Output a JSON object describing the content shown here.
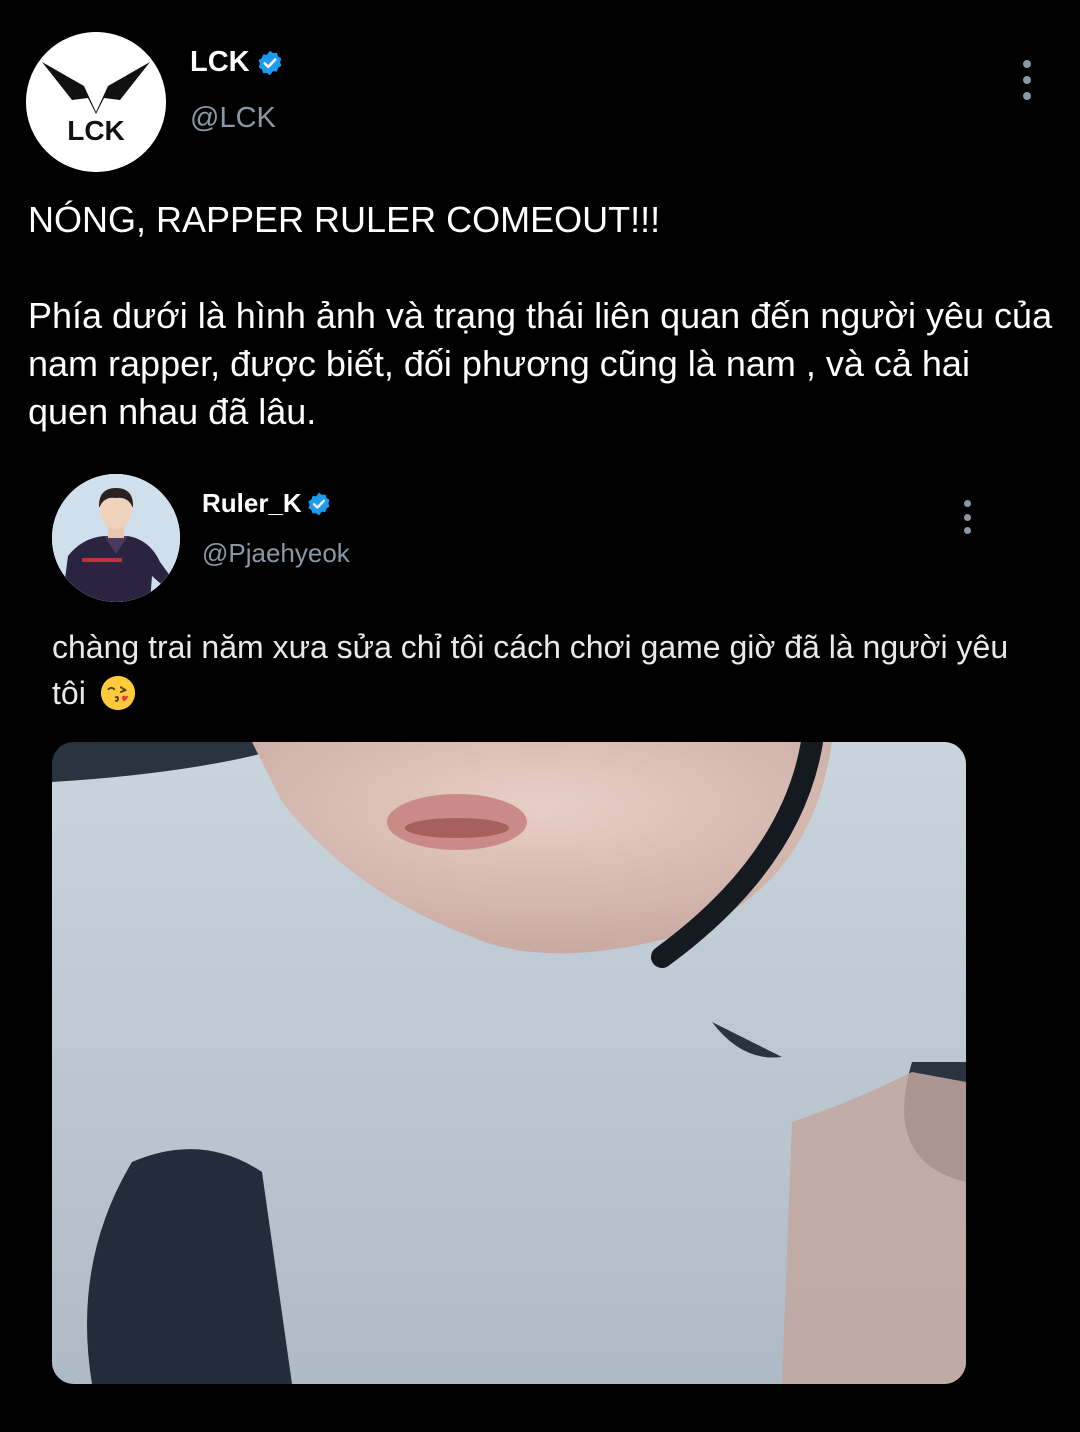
{
  "tweet": {
    "author": {
      "name": "LCK",
      "handle": "@LCK",
      "logo_text": "LCK",
      "verified": true
    },
    "headline": "NÓNG, RAPPER RULER COMEOUT!!!",
    "body": "Phía dưới là hình ảnh và trạng thái liên quan đến người yêu của nam rapper, được biết, đối phương cũng là nam , và cả hai quen nhau đã lâu.",
    "more_icon": "more-vertical-icon"
  },
  "embedded_tweet": {
    "author": {
      "name": "Ruler_K",
      "handle": "@Pjaehyeok",
      "verified": true
    },
    "text": "chàng trai năm xưa sửa chỉ tôi cách chơi game giờ đã là người yêu tôi",
    "emoji": "face-blowing-kiss-emoji",
    "more_icon": "more-vertical-icon"
  },
  "colors": {
    "background": "#000000",
    "text": "#ffffff",
    "secondary_text": "#8b98a5",
    "verified_badge": "#1d9bf0",
    "logo_mark": "#111111"
  }
}
